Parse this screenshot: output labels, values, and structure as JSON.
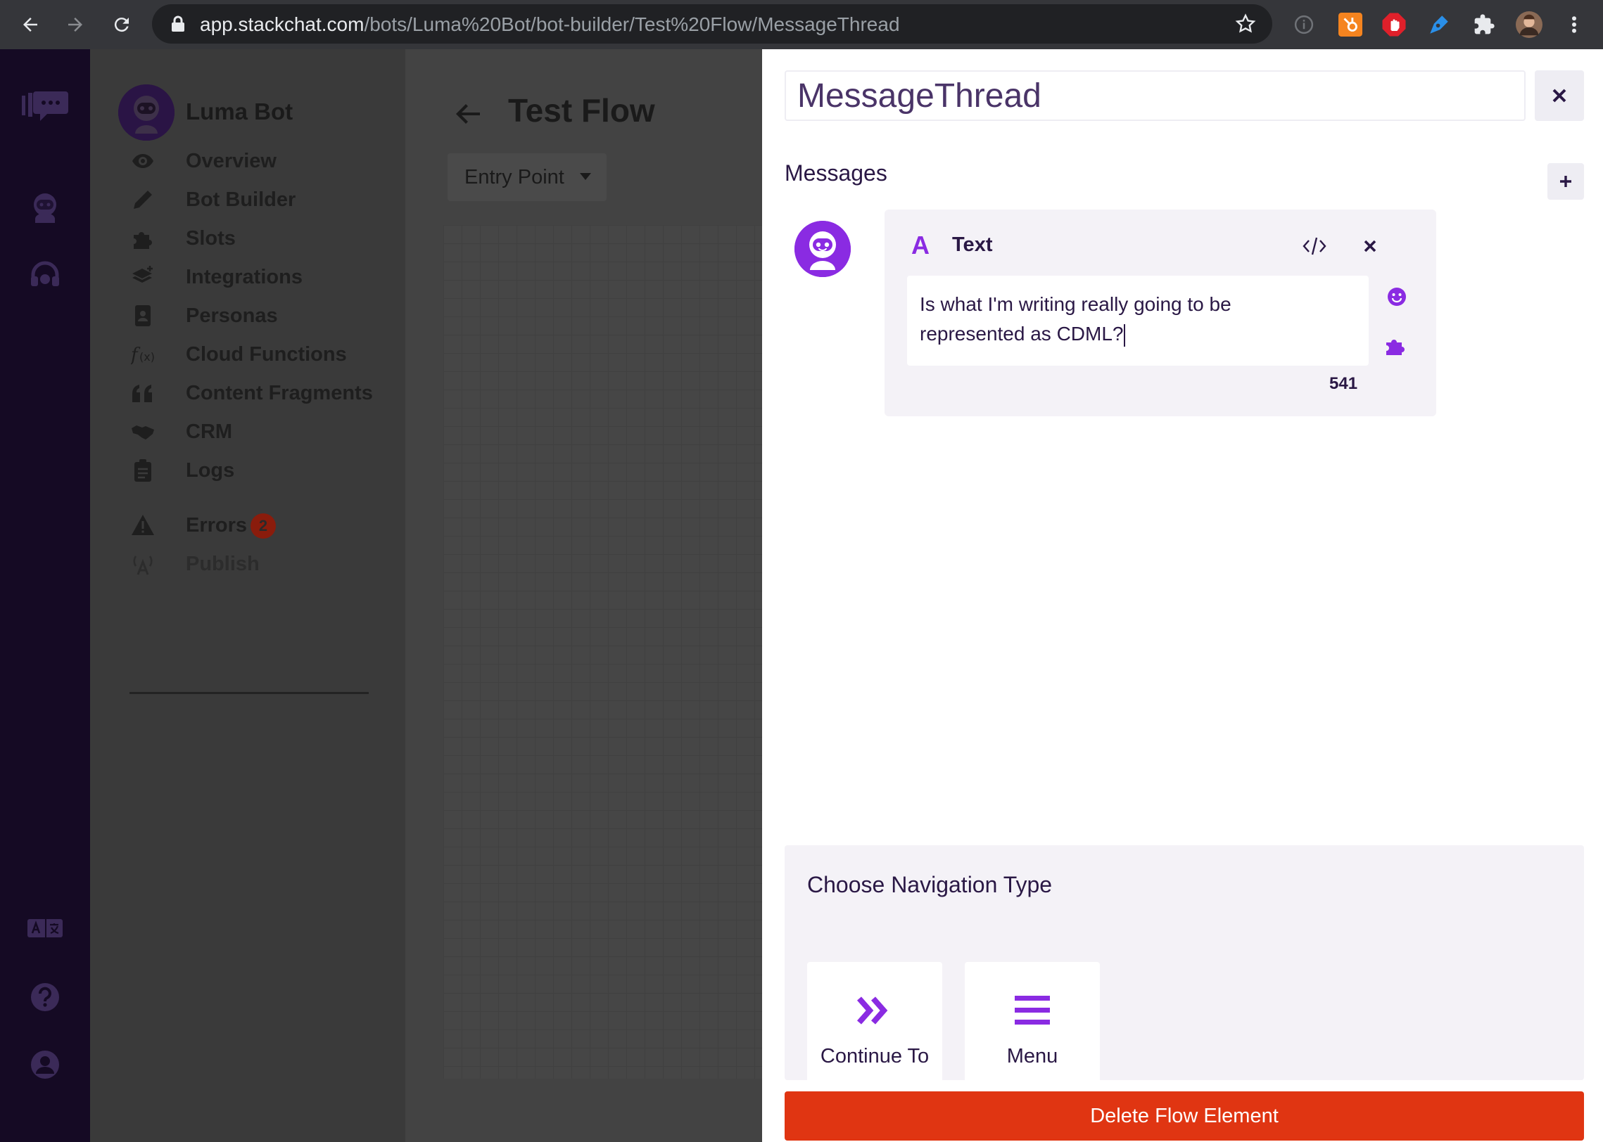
{
  "browser": {
    "url_host": "app.stackchat.com",
    "url_path": "/bots/Luma%20Bot/bot-builder/Test%20Flow/MessageThread",
    "icons": [
      "back-icon",
      "forward-icon",
      "reload-icon",
      "lock-icon",
      "bookmark-star-icon",
      "info-icon",
      "hubspot-icon",
      "adblock-icon",
      "pen-tool-icon",
      "extensions-icon",
      "profile-avatar",
      "more-menu-icon"
    ]
  },
  "rail": {
    "icons": [
      "stackchat-logo-icon",
      "bot-icon",
      "support-headset-icon",
      "translate-icon",
      "help-icon",
      "account-icon"
    ]
  },
  "sidebar": {
    "bot_name": "Luma Bot",
    "items": [
      {
        "label": "Overview",
        "icon": "eye-icon"
      },
      {
        "label": "Bot Builder",
        "icon": "pencil-icon"
      },
      {
        "label": "Slots",
        "icon": "puzzle-icon"
      },
      {
        "label": "Integrations",
        "icon": "layers-plus-icon"
      },
      {
        "label": "Personas",
        "icon": "id-badge-icon"
      },
      {
        "label": "Cloud Functions",
        "icon": "function-icon"
      },
      {
        "label": "Content Fragments",
        "icon": "quote-icon"
      },
      {
        "label": "CRM",
        "icon": "handshake-icon"
      },
      {
        "label": "Logs",
        "icon": "clipboard-icon"
      },
      {
        "label": "Errors",
        "icon": "warning-icon",
        "badge": "2"
      },
      {
        "label": "Publish",
        "icon": "broadcast-icon"
      }
    ]
  },
  "main": {
    "flow_title": "Test Flow",
    "entry_dropdown": "Entry Point"
  },
  "panel": {
    "element_name": "MessageThread",
    "messages_heading": "Messages",
    "message": {
      "type_glyph": "A",
      "type_label": "Text",
      "text_line1": "Is what I'm writing really going to be",
      "text_line2": "represented as CDML?",
      "char_count": "541"
    },
    "navigation": {
      "heading": "Choose Navigation Type",
      "options": [
        {
          "label": "Continue To",
          "icon": "double-chevron-right-icon"
        },
        {
          "label": "Menu",
          "icon": "hamburger-menu-icon"
        }
      ]
    },
    "delete_label": "Delete Flow Element"
  },
  "colors": {
    "accent_purple": "#8a2be2",
    "delete_red": "#e03512",
    "rail_bg": "#150a24",
    "panel_text": "#2a1845"
  }
}
